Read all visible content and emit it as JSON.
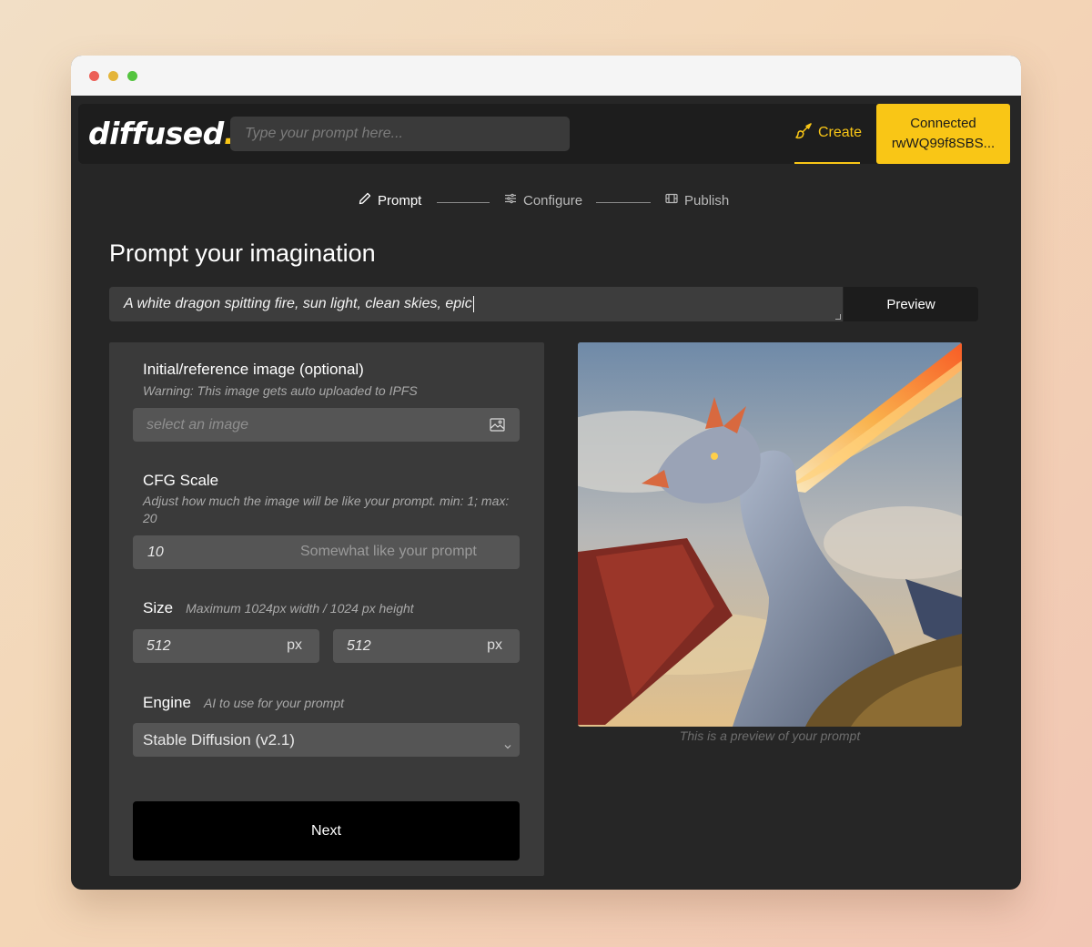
{
  "navbar": {
    "logo_text": "diffused",
    "logo_dot": ".",
    "search_placeholder": "Type your prompt here...",
    "create_label": "Create",
    "connect_status": "Connected",
    "connect_address": "rwWQ99f8SBS..."
  },
  "steps": [
    {
      "label": "Prompt",
      "icon": "pencil-icon",
      "active": true
    },
    {
      "label": "Configure",
      "icon": "sliders-icon",
      "active": false
    },
    {
      "label": "Publish",
      "icon": "film-icon",
      "active": false
    }
  ],
  "main": {
    "heading": "Prompt your imagination",
    "prompt_value": "A white dragon spitting fire, sun light, clean skies, epic",
    "preview_label": "Preview"
  },
  "form": {
    "reference": {
      "label": "Initial/reference image (optional)",
      "hint": "Warning: This image gets auto uploaded to IPFS",
      "placeholder": "select an image"
    },
    "cfg": {
      "label": "CFG Scale",
      "hint": "Adjust how much the image will be like your prompt. min: 1; max: 20",
      "value": "10",
      "descriptor": "Somewhat like your prompt"
    },
    "size": {
      "label": "Size",
      "hint": "Maximum 1024px width / 1024 px height",
      "width": "512",
      "height": "512",
      "unit": "px"
    },
    "engine": {
      "label": "Engine",
      "hint": "AI to use for your prompt",
      "selected": "Stable Diffusion (v2.1)"
    },
    "next_label": "Next"
  },
  "preview": {
    "caption": "This is a preview of your prompt"
  },
  "colors": {
    "accent": "#f9c616",
    "background": "#262626",
    "panel": "#3a3a3a"
  }
}
